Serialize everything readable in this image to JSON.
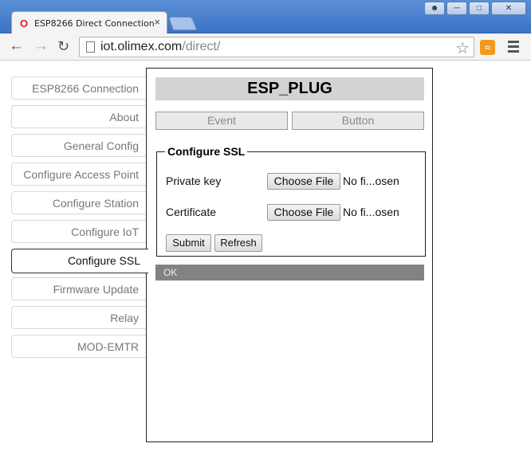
{
  "browser": {
    "tab_title": "ESP8266 Direct Connection",
    "tab_favicon": "O",
    "tab_close": "×",
    "url_host": "iot.olimex.com",
    "url_path": "/direct/",
    "icons": {
      "back": "back-arrow-icon",
      "forward": "forward-arrow-icon",
      "reload": "reload-icon",
      "star": "bookmark-star-icon",
      "rss": "rss-feed-icon",
      "menu": "hamburger-menu-icon"
    }
  },
  "sidebar": {
    "items": [
      {
        "label": "ESP8266 Connection"
      },
      {
        "label": "About"
      },
      {
        "label": "General Config"
      },
      {
        "label": "Configure Access Point"
      },
      {
        "label": "Configure Station"
      },
      {
        "label": "Configure IoT"
      },
      {
        "label": "Configure SSL",
        "active": true
      },
      {
        "label": "Firmware Update"
      },
      {
        "label": "Relay"
      },
      {
        "label": "MOD-EMTR"
      }
    ]
  },
  "main": {
    "device_title": "ESP_PLUG",
    "mode_buttons": {
      "event": "Event",
      "button": "Button"
    },
    "ssl": {
      "legend": "Configure SSL",
      "private_key_label": "Private key",
      "certificate_label": "Certificate",
      "choose_file_label": "Choose File",
      "private_key_status": "No fi...osen",
      "certificate_status": "No fi...osen",
      "submit_label": "Submit",
      "refresh_label": "Refresh"
    },
    "status": "OK"
  },
  "colors": {
    "title_bg": "#d3d3d3",
    "status_bg": "#828282",
    "chrome_blue": "#4a80cc"
  }
}
